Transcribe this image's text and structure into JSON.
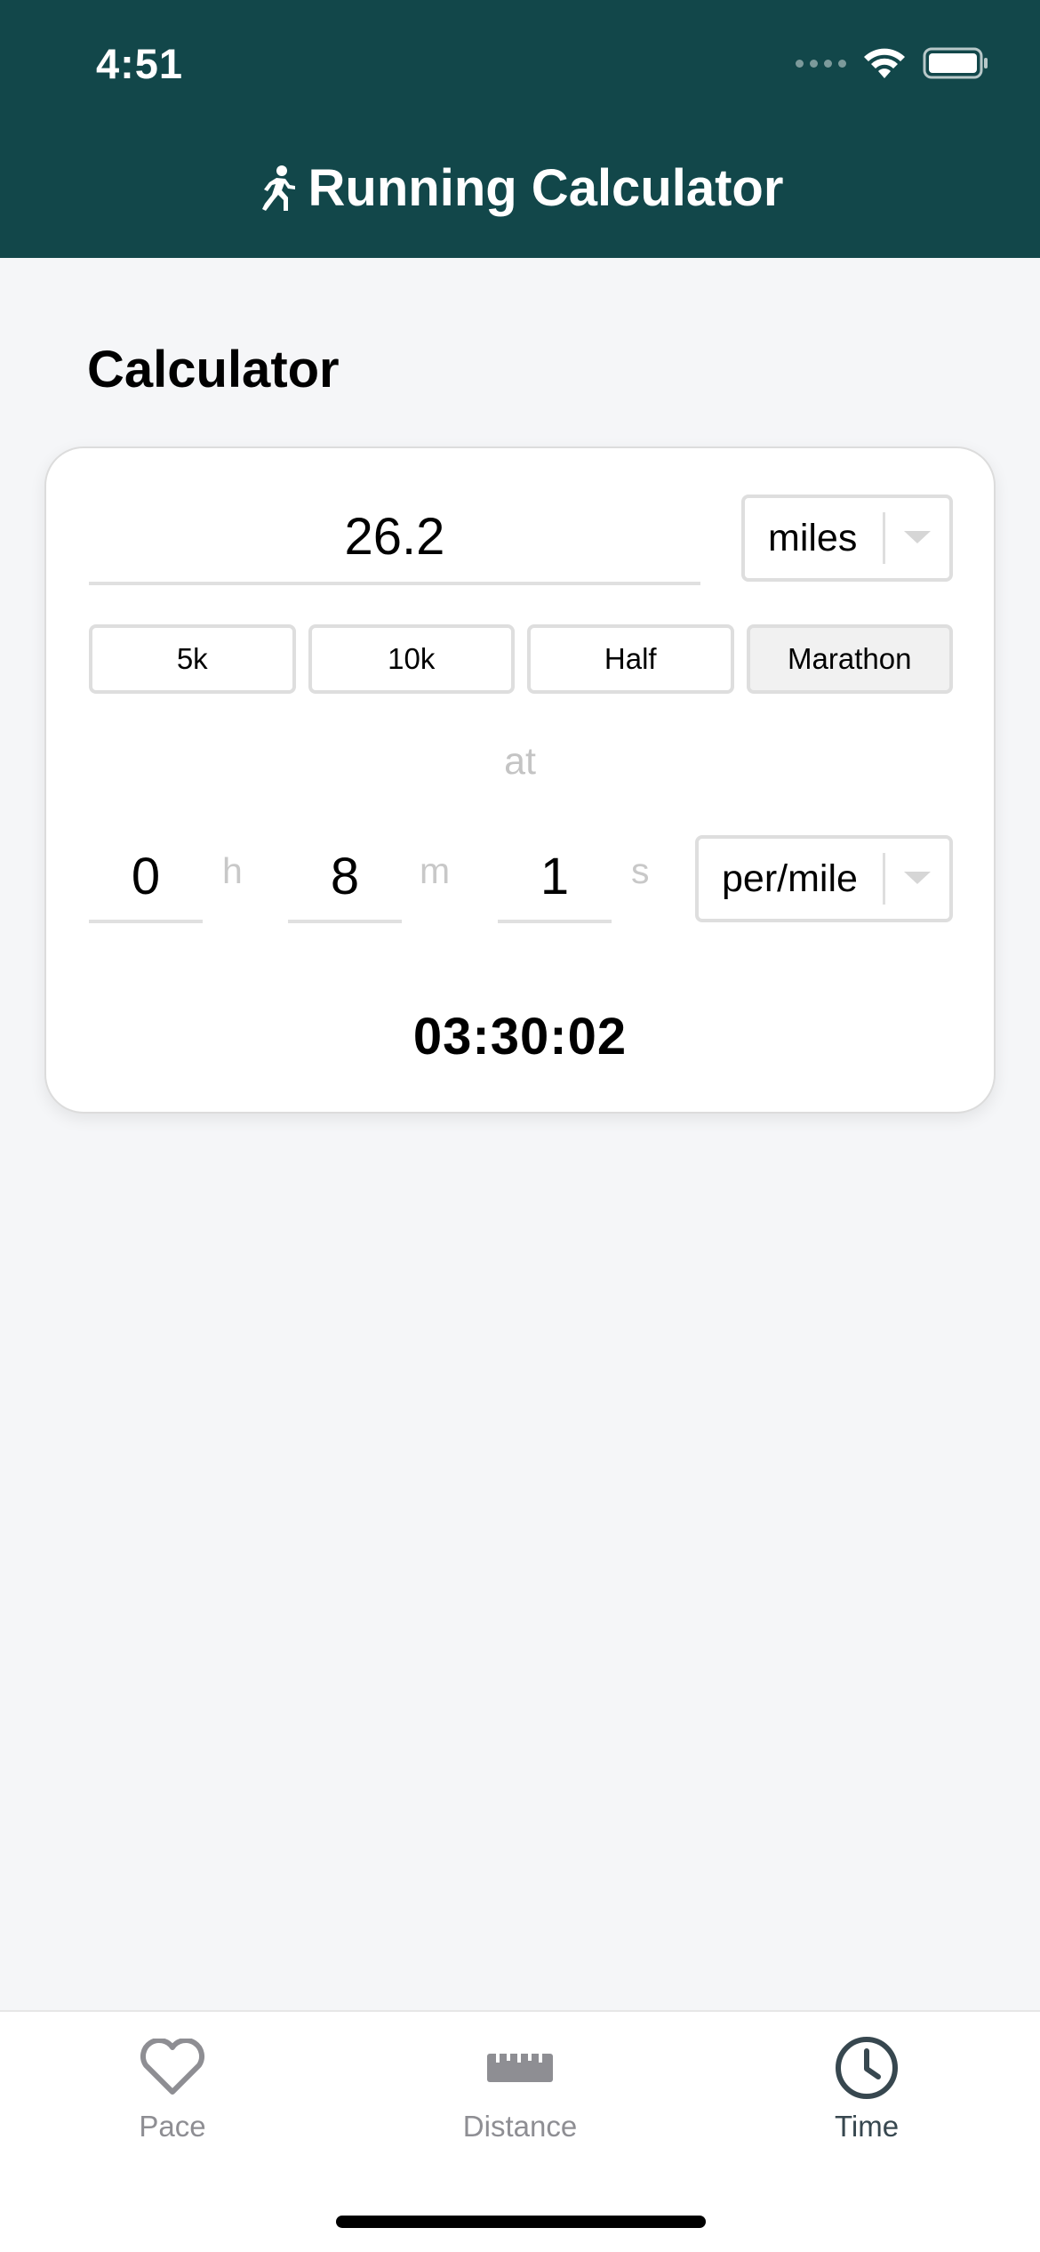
{
  "status_bar": {
    "time": "4:51"
  },
  "header": {
    "title": "Running Calculator",
    "icon": "running-person-icon"
  },
  "section": {
    "title": "Calculator"
  },
  "calculator": {
    "distance_value": "26.2",
    "distance_unit": "miles",
    "presets": [
      {
        "label": "5k",
        "selected": false
      },
      {
        "label": "10k",
        "selected": false
      },
      {
        "label": "Half",
        "selected": false
      },
      {
        "label": "Marathon",
        "selected": true
      }
    ],
    "at_label": "at",
    "pace": {
      "hours": "0",
      "hours_unit": "h",
      "minutes": "8",
      "minutes_unit": "m",
      "seconds": "1",
      "seconds_unit": "s"
    },
    "pace_unit": "per/mile",
    "result": "03:30:02"
  },
  "tab_bar": {
    "tabs": [
      {
        "label": "Pace",
        "icon": "heart-icon",
        "active": false
      },
      {
        "label": "Distance",
        "icon": "ruler-icon",
        "active": false
      },
      {
        "label": "Time",
        "icon": "clock-icon",
        "active": true
      }
    ]
  },
  "colors": {
    "header_bg": "#12474a",
    "background": "#f5f6f8",
    "tab_active": "#37474f",
    "tab_inactive": "#8e8e93"
  }
}
